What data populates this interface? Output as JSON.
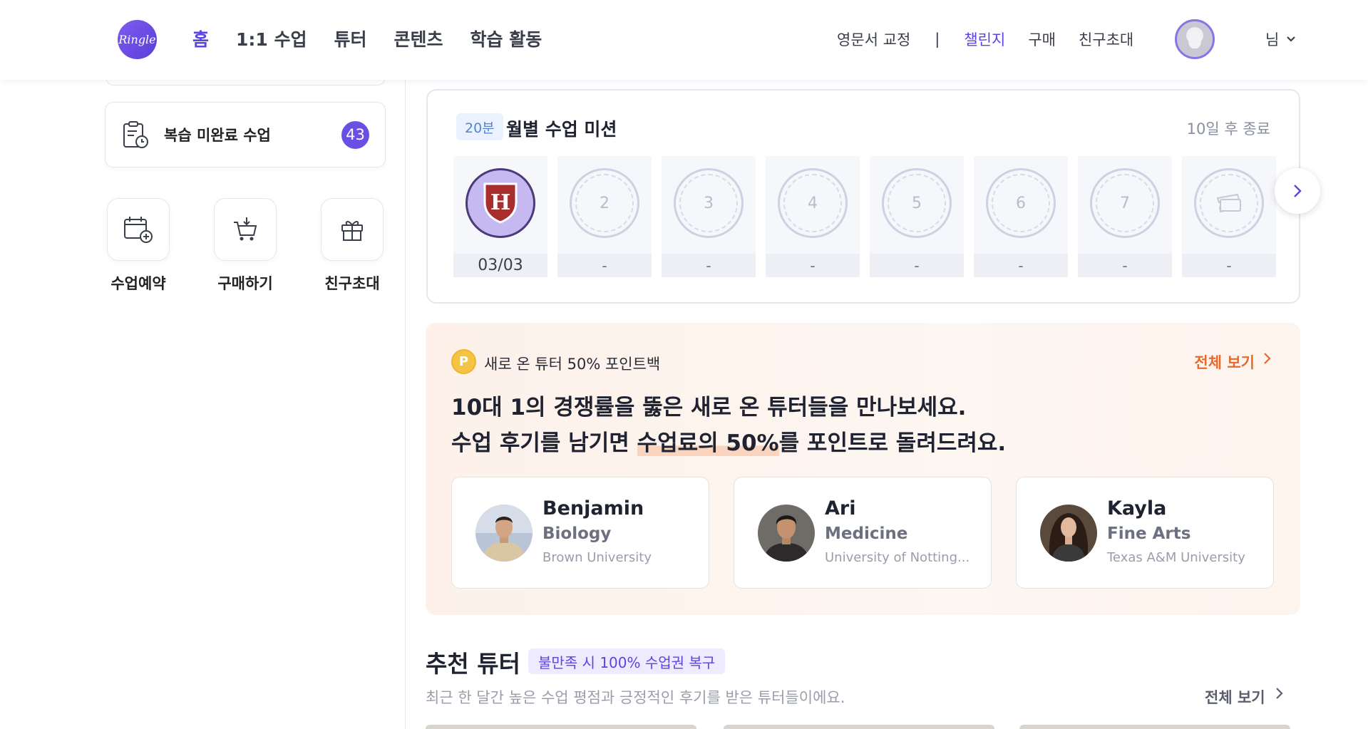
{
  "header": {
    "logo_text": "Ringle",
    "nav": [
      "홈",
      "1:1 수업",
      "튜터",
      "콘텐츠",
      "학습 활동"
    ],
    "utility": {
      "proofreading": "영문서 교정",
      "separator": "|",
      "challenge": "챌린지",
      "purchase": "구매",
      "invite": "친구초대"
    },
    "user_label": "님"
  },
  "sidebar": {
    "review_card": {
      "label": "복습 미완료 수업",
      "count": "43"
    },
    "quick_actions": [
      {
        "label": "수업예약",
        "icon": "calendar-add-icon"
      },
      {
        "label": "구매하기",
        "icon": "cart-icon"
      },
      {
        "label": "친구초대",
        "icon": "gift-icon"
      }
    ]
  },
  "mission": {
    "tag": "20분",
    "title": "월별 수업 미션",
    "ends": "10일 후 종료",
    "stamps": [
      {
        "label": "H",
        "date": "03/03",
        "done": true
      },
      {
        "label": "2",
        "date": "-"
      },
      {
        "label": "3",
        "date": "-"
      },
      {
        "label": "4",
        "date": "-"
      },
      {
        "label": "5",
        "date": "-"
      },
      {
        "label": "6",
        "date": "-"
      },
      {
        "label": "7",
        "date": "-"
      },
      {
        "label": "",
        "date": "-",
        "icon": "ticket-icon"
      }
    ]
  },
  "promo": {
    "coin": "P",
    "subtitle": "새로 온 튜터 50% 포인트백",
    "view_all": "전체 보기",
    "headline_line1": "10대 1의 경쟁률을 뚫은 새로 온 튜터들을 만나보세요.",
    "headline_line2_pre": "수업 후기를 남기면 ",
    "headline_line2_hl": "수업료의 50%",
    "headline_line2_post": "를 포인트로 돌려드려요.",
    "tutors": [
      {
        "name": "Benjamin",
        "field": "Biology",
        "university": "Brown University"
      },
      {
        "name": "Ari",
        "field": "Medicine",
        "university": "University of Notting..."
      },
      {
        "name": "Kayla",
        "field": "Fine Arts",
        "university": "Texas A&M University"
      }
    ]
  },
  "recommended": {
    "title": "추천 튜터",
    "tag": "불만족 시 100% 수업권 복구",
    "subtitle": "최근 한 달간 높은 수업 평점과 긍정적인 후기를 받은 튜터들이에요.",
    "view_all": "전체 보기"
  },
  "colors": {
    "brand": "#5b45e0",
    "accent_orange": "#e8692a",
    "promo_bg": "#fdf1ea",
    "badge": "#6a4fe3"
  }
}
